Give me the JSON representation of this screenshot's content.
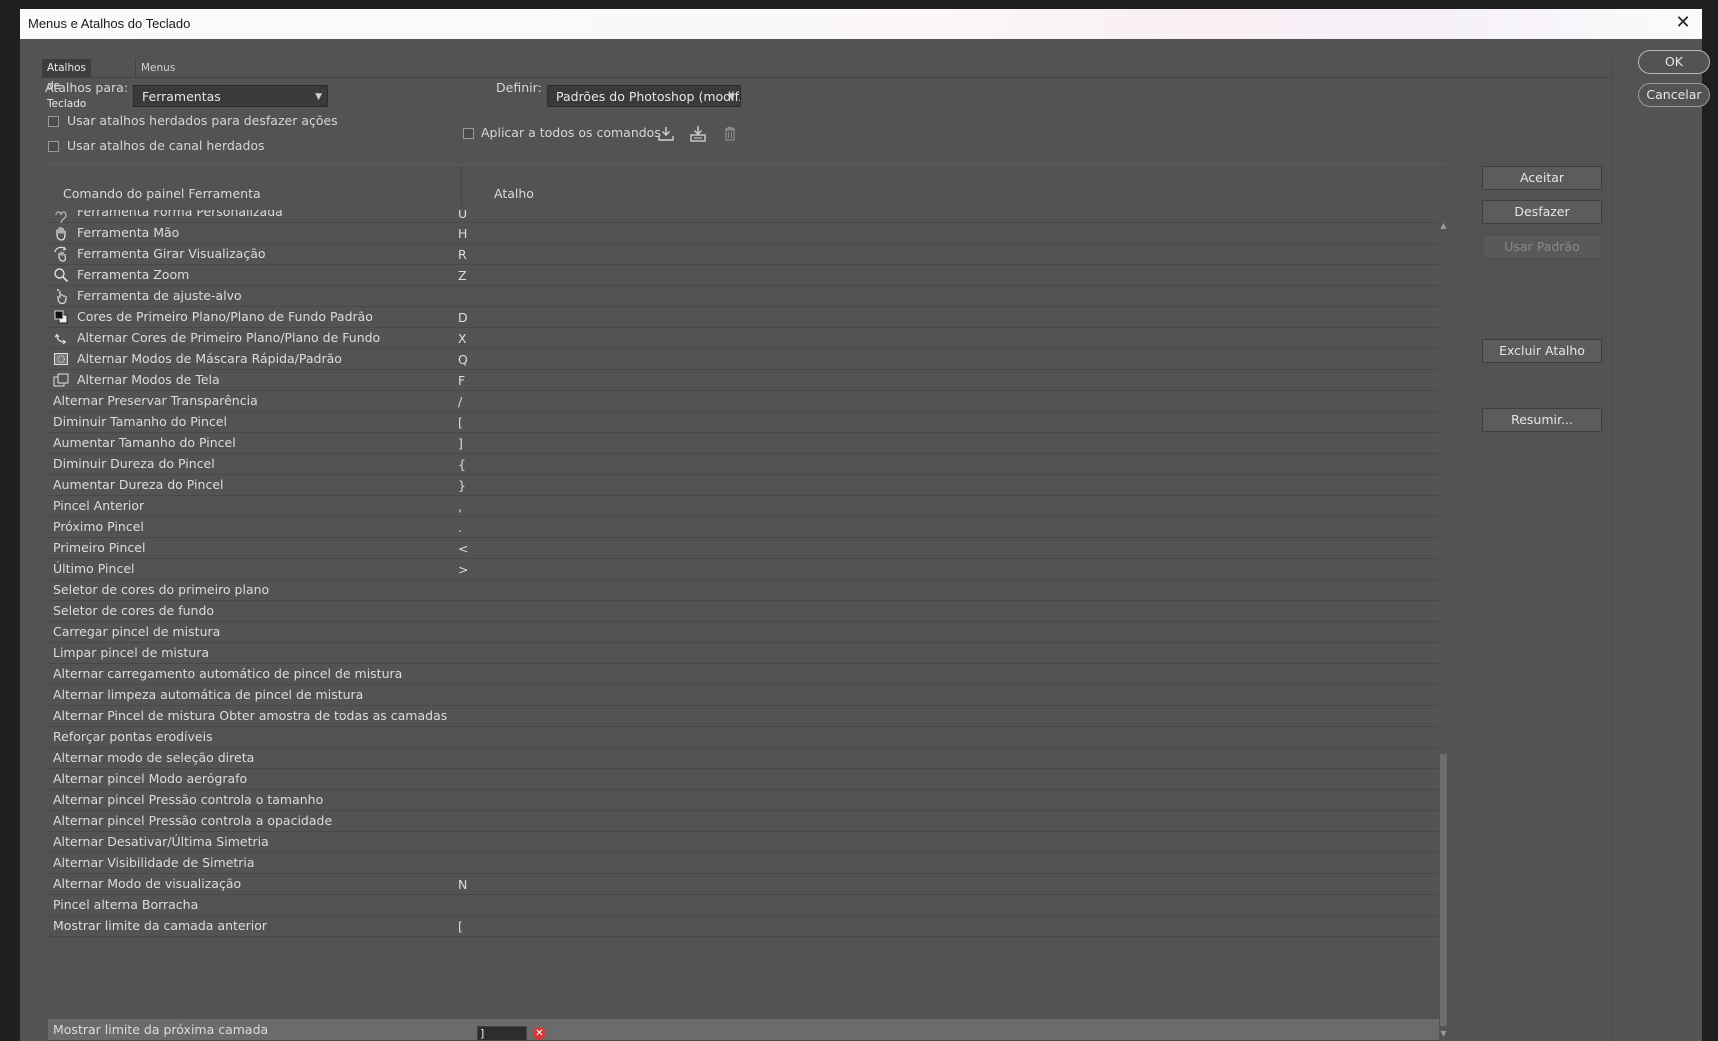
{
  "window": {
    "title": "Menus e Atalhos do Teclado",
    "close_glyph": "✕"
  },
  "tabs": [
    {
      "label": "Atalhos de Teclado"
    },
    {
      "label": "Menus"
    }
  ],
  "controls": {
    "shortcuts_for_label": "Atalhos para:",
    "shortcuts_for_value": "Ferramentas",
    "set_label": "Definir:",
    "set_value": "Padrões do Photoshop (modif...",
    "undo_checkbox": "Usar atalhos herdados para desfazer ações",
    "channel_checkbox": "Usar atalhos de canal herdados",
    "apply_all_checkbox": "Aplicar a todos os comandos"
  },
  "table": {
    "col_command": "Comando do painel Ferramenta",
    "col_shortcut": "Atalho",
    "partial_row": {
      "command": "Ferramenta Forma Personalizada",
      "shortcut": "U"
    },
    "rows": [
      {
        "command": "Ferramenta Mão",
        "shortcut": "H",
        "icon": "hand-tool-icon"
      },
      {
        "command": "Ferramenta Girar Visualização",
        "shortcut": "R",
        "icon": "rotate-view-icon"
      },
      {
        "command": "Ferramenta Zoom",
        "shortcut": "Z",
        "icon": "zoom-icon"
      },
      {
        "command": "Ferramenta de ajuste-alvo",
        "shortcut": "",
        "icon": "targeted-adjustment-icon"
      },
      {
        "command": "Cores de Primeiro Plano/Plano de Fundo Padrão",
        "shortcut": "D",
        "icon": "default-colors-icon"
      },
      {
        "command": "Alternar Cores de Primeiro Plano/Plano de Fundo",
        "shortcut": "X",
        "icon": "swap-colors-icon"
      },
      {
        "command": "Alternar Modos de Máscara Rápida/Padrão",
        "shortcut": "Q",
        "icon": "quick-mask-icon"
      },
      {
        "command": "Alternar Modos de Tela",
        "shortcut": "F",
        "icon": "screen-mode-icon"
      },
      {
        "command": "Alternar Preservar Transparência",
        "shortcut": "/"
      },
      {
        "command": "Diminuir Tamanho do Pincel",
        "shortcut": "["
      },
      {
        "command": "Aumentar Tamanho do Pincel",
        "shortcut": "]"
      },
      {
        "command": "Diminuir Dureza do Pincel",
        "shortcut": "{"
      },
      {
        "command": "Aumentar Dureza do Pincel",
        "shortcut": "}"
      },
      {
        "command": "Pincel Anterior",
        "shortcut": ","
      },
      {
        "command": "Próximo Pincel",
        "shortcut": "."
      },
      {
        "command": "Primeiro Pincel",
        "shortcut": "<"
      },
      {
        "command": "Último Pincel",
        "shortcut": ">"
      },
      {
        "command": "Seletor de cores do primeiro plano",
        "shortcut": ""
      },
      {
        "command": "Seletor de cores de fundo",
        "shortcut": ""
      },
      {
        "command": "Carregar pincel de mistura",
        "shortcut": ""
      },
      {
        "command": "Limpar pincel de mistura",
        "shortcut": ""
      },
      {
        "command": "Alternar carregamento automático de pincel de mistura",
        "shortcut": ""
      },
      {
        "command": "Alternar limpeza automática de pincel de mistura",
        "shortcut": ""
      },
      {
        "command": "Alternar Pincel de mistura Obter amostra de todas as camadas",
        "shortcut": ""
      },
      {
        "command": "Reforçar pontas erodíveis",
        "shortcut": ""
      },
      {
        "command": "Alternar modo de seleção direta",
        "shortcut": ""
      },
      {
        "command": "Alternar pincel Modo aerógrafo",
        "shortcut": ""
      },
      {
        "command": "Alternar pincel Pressão controla o tamanho",
        "shortcut": ""
      },
      {
        "command": "Alternar pincel Pressão controla a opacidade",
        "shortcut": ""
      },
      {
        "command": "Alternar Desativar/Última Simetria",
        "shortcut": ""
      },
      {
        "command": "Alternar Visibilidade de Simetria",
        "shortcut": ""
      },
      {
        "command": "Alternar Modo de visualização",
        "shortcut": "N"
      },
      {
        "command": "Pincel alterna Borracha",
        "shortcut": ""
      },
      {
        "command": "Mostrar limite da camada anterior",
        "shortcut": "["
      }
    ],
    "selected_row": {
      "command": "Mostrar limite da próxima camada",
      "editing_value": "]"
    }
  },
  "side_buttons": {
    "accept": "Aceitar",
    "undo": "Desfazer",
    "use_default": "Usar Padrão",
    "delete_shortcut": "Excluir Atalho",
    "summarize": "Resumir..."
  },
  "dialog_buttons": {
    "ok": "OK",
    "cancel": "Cancelar"
  },
  "colors": {
    "panel": "#535353",
    "selected_row": "#6b6b6b",
    "clear_icon": "#d23a3a"
  }
}
